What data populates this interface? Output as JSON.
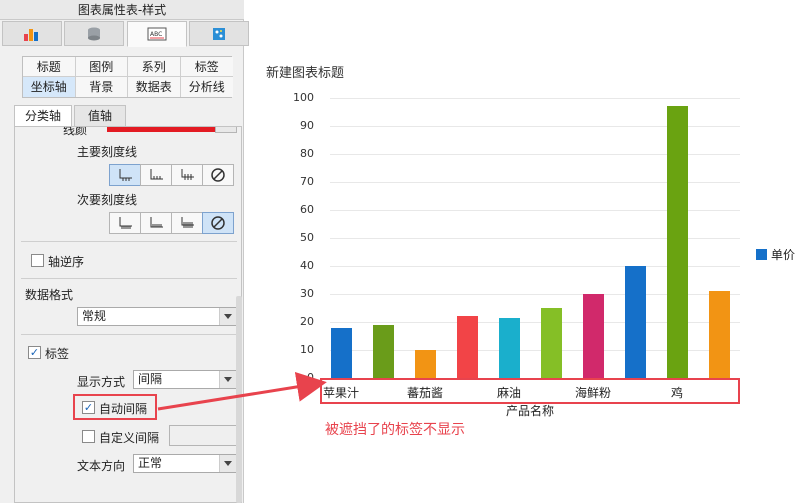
{
  "panel": {
    "title": "图表属性表-样式",
    "icon_tabs": [
      {
        "name": "chart-type-icon",
        "glyph": "▟"
      },
      {
        "name": "database-icon",
        "glyph": "≡"
      },
      {
        "name": "style-icon",
        "glyph": "ABC"
      },
      {
        "name": "effect-icon",
        "glyph": "✦"
      }
    ],
    "grid_tabs_row1": [
      "标题",
      "图例",
      "系列",
      "标签"
    ],
    "grid_tabs_row2": [
      "坐标轴",
      "背景",
      "数据表",
      "分析线"
    ],
    "sub_tabs": [
      "分类轴",
      "值轴"
    ],
    "cut_label": "线颜",
    "major_tick_label": "主要刻度线",
    "minor_tick_label": "次要刻度线",
    "reverse_axis_label": "轴逆序",
    "data_format_label": "数据格式",
    "data_format_value": "常规",
    "labels_label": "标签",
    "display_mode_label": "显示方式",
    "display_mode_value": "间隔",
    "auto_interval_label": "自动间隔",
    "custom_interval_label": "自定义间隔",
    "text_direction_label": "文本方向",
    "text_direction_value": "正常"
  },
  "chart_data": {
    "type": "bar",
    "title": "新建图表标题",
    "xlabel": "产品名称",
    "ylabel": "",
    "ylim": [
      0,
      100
    ],
    "yticks": [
      0,
      10,
      20,
      30,
      40,
      50,
      60,
      70,
      80,
      90,
      100
    ],
    "categories": [
      "苹果汁",
      "",
      "蕃茄酱",
      "",
      "麻油",
      "",
      "海鲜粉",
      "",
      "鸡",
      ""
    ],
    "series": [
      {
        "name": "单价",
        "values": [
          18,
          19,
          10,
          22,
          21.35,
          25,
          30,
          40,
          97,
          31
        ]
      }
    ],
    "bar_colors": [
      "#1570c9",
      "#6a9c1a",
      "#f29414",
      "#f24447",
      "#1aafcc",
      "#85bf26",
      "#d1296b",
      "#1570c9",
      "#6aa311",
      "#f29414"
    ]
  },
  "annotation": {
    "note": "被遮挡了的标签不显示",
    "color": "#e8434d"
  }
}
